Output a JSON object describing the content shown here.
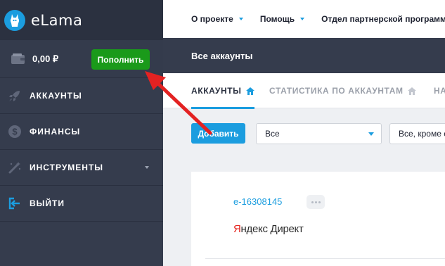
{
  "sidebar": {
    "logo_text": "eLama",
    "balance": "0,00 ₽",
    "topup_label": "Пополнить",
    "items": [
      {
        "label": "АККАУНТЫ",
        "icon": "rocket-icon"
      },
      {
        "label": "ФИНАНСЫ",
        "icon": "dollar-icon"
      },
      {
        "label": "ИНСТРУМЕНТЫ",
        "icon": "magic-wand-icon"
      },
      {
        "label": "ВЫЙТИ",
        "icon": "logout-icon"
      }
    ]
  },
  "topnav": {
    "items": [
      "О проекте",
      "Помощь",
      "Отдел партнерской программ"
    ]
  },
  "page": {
    "title": "Все аккаунты"
  },
  "tabs": [
    {
      "label": "АККАУНТЫ",
      "active": true
    },
    {
      "label": "СТАТИСТИКА ПО АККАУНТАМ",
      "active": false
    },
    {
      "label": "НА",
      "active": false
    }
  ],
  "filters": {
    "add_label": "Добавить",
    "select1_value": "Все",
    "select2_value": "Все, кроме с"
  },
  "card": {
    "account_id": "e-16308145",
    "platform_first": "Я",
    "platform_rest": "ндекс Директ"
  },
  "colors": {
    "accent": "#1b9ddf",
    "sidebar": "#353c4d",
    "topup": "#1a9a1a",
    "annotation_arrow": "#e32222"
  }
}
